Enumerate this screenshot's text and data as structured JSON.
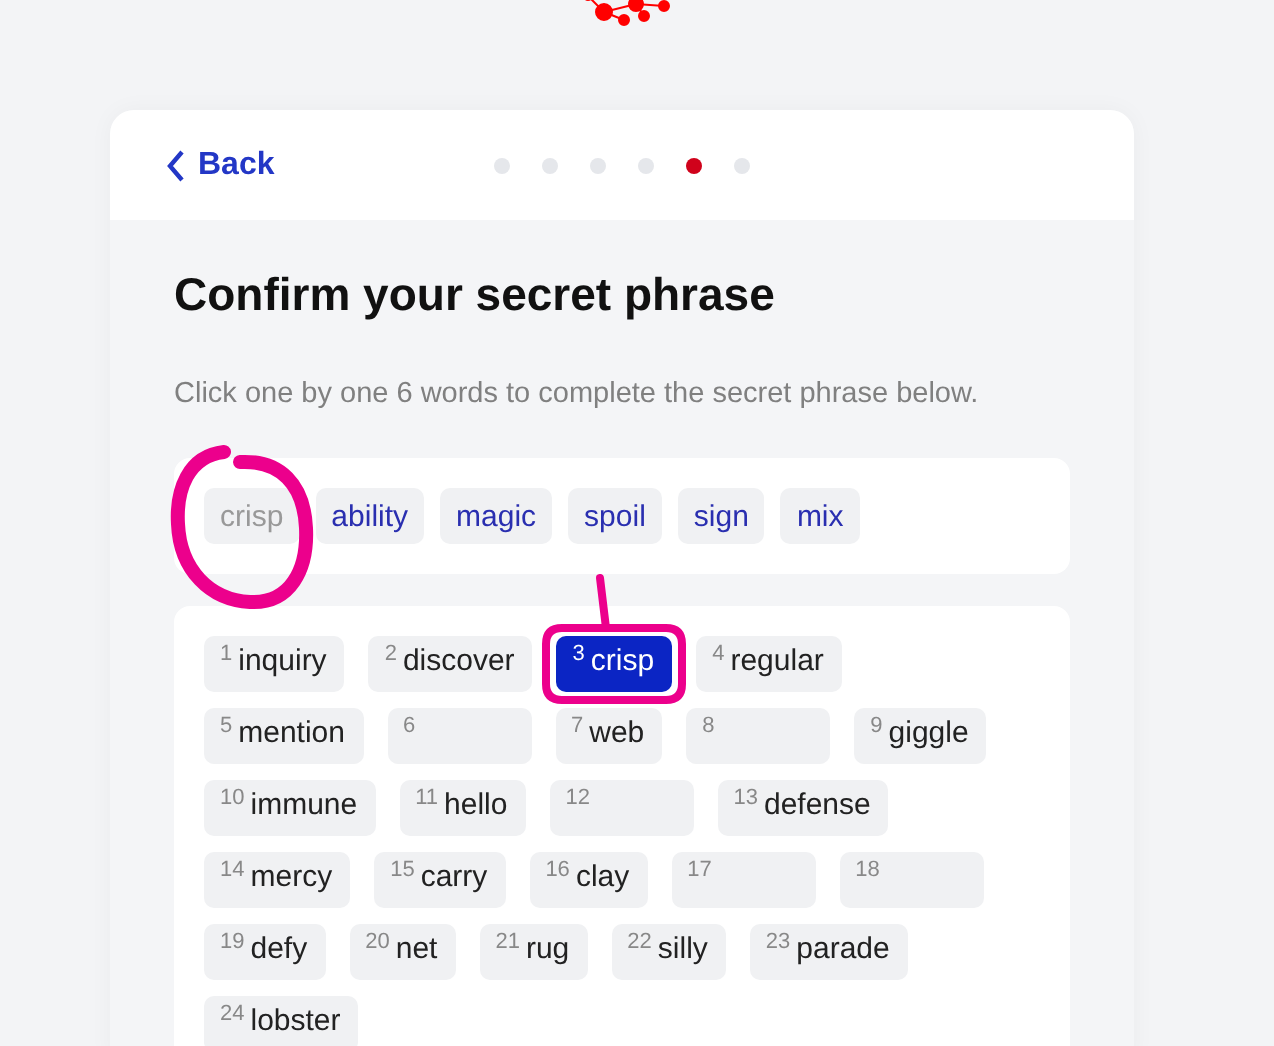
{
  "header": {
    "back_label": "Back",
    "steps": [
      {
        "selected": false
      },
      {
        "selected": false
      },
      {
        "selected": false
      },
      {
        "selected": false
      },
      {
        "selected": true
      },
      {
        "selected": false
      }
    ]
  },
  "title": "Confirm your secret phrase",
  "subtitle": "Click one by one 6 words to complete the secret phrase below.",
  "choices": [
    {
      "word": "crisp",
      "used": true
    },
    {
      "word": "ability",
      "used": false
    },
    {
      "word": "magic",
      "used": false
    },
    {
      "word": "spoil",
      "used": false
    },
    {
      "word": "sign",
      "used": false
    },
    {
      "word": "mix",
      "used": false
    }
  ],
  "phrase": [
    {
      "kind": "word",
      "number": "1",
      "word": "inquiry",
      "selected": false
    },
    {
      "kind": "word",
      "number": "2",
      "word": "discover",
      "selected": false
    },
    {
      "kind": "word",
      "number": "3",
      "word": "crisp",
      "selected": true
    },
    {
      "kind": "word",
      "number": "4",
      "word": "regular",
      "selected": false
    },
    {
      "kind": "word",
      "number": "5",
      "word": "mention",
      "selected": false
    },
    {
      "kind": "blank",
      "number": "6",
      "selected": false
    },
    {
      "kind": "word",
      "number": "7",
      "word": "web",
      "selected": false
    },
    {
      "kind": "blank",
      "number": "8",
      "selected": false
    },
    {
      "kind": "word",
      "number": "9",
      "word": "giggle",
      "selected": false
    },
    {
      "kind": "word",
      "number": "10",
      "word": "immune",
      "selected": false
    },
    {
      "kind": "word",
      "number": "11",
      "word": "hello",
      "selected": false
    },
    {
      "kind": "blank",
      "number": "12",
      "selected": false
    },
    {
      "kind": "word",
      "number": "13",
      "word": "defense",
      "selected": false
    },
    {
      "kind": "word",
      "number": "14",
      "word": "mercy",
      "selected": false
    },
    {
      "kind": "word",
      "number": "15",
      "word": "carry",
      "selected": false
    },
    {
      "kind": "word",
      "number": "16",
      "word": "clay",
      "selected": false
    },
    {
      "kind": "blank",
      "number": "17",
      "selected": false
    },
    {
      "kind": "blank",
      "number": "18",
      "selected": false
    },
    {
      "kind": "word",
      "number": "19",
      "word": "defy",
      "selected": false
    },
    {
      "kind": "word",
      "number": "20",
      "word": "net",
      "selected": false
    },
    {
      "kind": "word",
      "number": "21",
      "word": "rug",
      "selected": false
    },
    {
      "kind": "word",
      "number": "22",
      "word": "silly",
      "selected": false
    },
    {
      "kind": "word",
      "number": "23",
      "word": "parade",
      "selected": false
    },
    {
      "kind": "word",
      "number": "24",
      "word": "lobster",
      "selected": false
    }
  ]
}
